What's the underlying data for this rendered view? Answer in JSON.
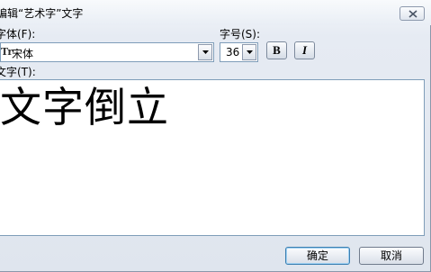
{
  "window": {
    "title": "编辑“艺术字”文字"
  },
  "font": {
    "label": "字体(F):",
    "value": "宋体",
    "type_glyph": "Tr"
  },
  "size": {
    "label": "字号(S):",
    "value": "36"
  },
  "format": {
    "bold_label": "B",
    "italic_label": "I"
  },
  "text": {
    "label": "文字(T):",
    "content": "文字倒立"
  },
  "buttons": {
    "ok": "确定",
    "cancel": "取消"
  },
  "icons": {
    "close": "close-icon",
    "dropdown": "chevron-down-icon"
  }
}
